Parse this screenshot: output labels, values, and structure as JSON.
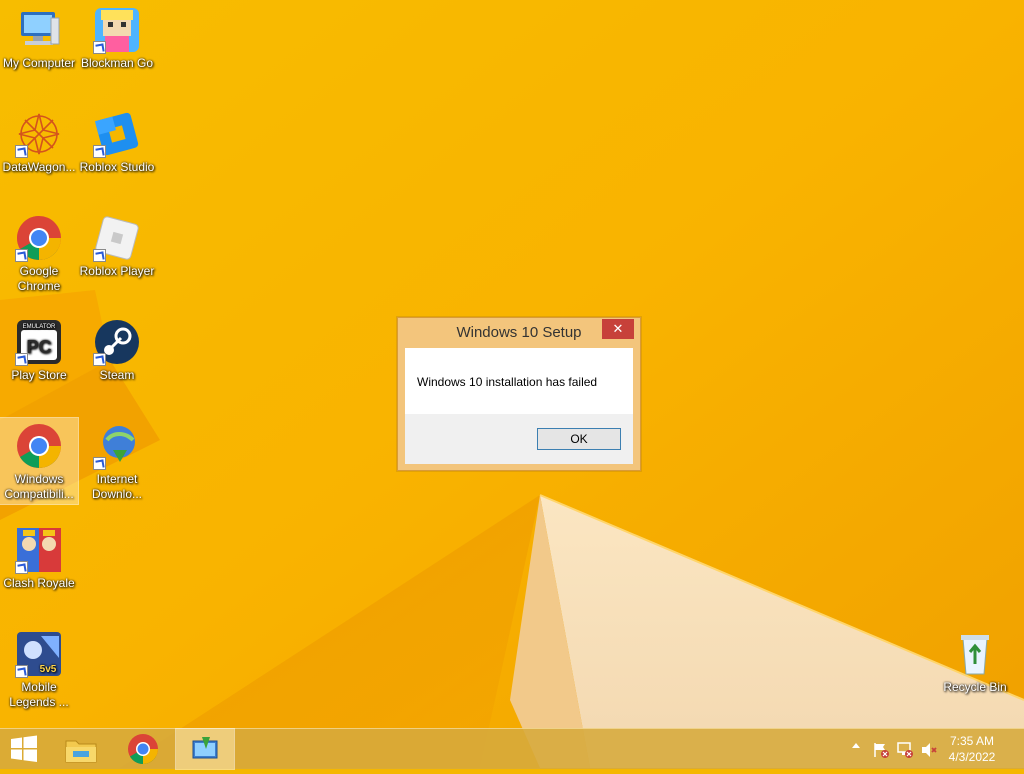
{
  "desktop": {
    "icons": [
      {
        "label": "My Computer",
        "icon": "my-computer-icon"
      },
      {
        "label": "Blockman Go",
        "icon": "blockman-go-icon"
      },
      {
        "label": "DataWagon...",
        "icon": "datawagon-icon"
      },
      {
        "label": "Roblox Studio",
        "icon": "roblox-studio-icon"
      },
      {
        "label": "Google Chrome",
        "icon": "chrome-icon"
      },
      {
        "label": "Roblox Player",
        "icon": "roblox-player-icon"
      },
      {
        "label": "Play Store",
        "icon": "play-store-emulator-icon",
        "badge": "EMULATOR",
        "text": "PC"
      },
      {
        "label": "Steam",
        "icon": "steam-icon"
      },
      {
        "label": "Windows Compatibili...",
        "icon": "chrome-icon"
      },
      {
        "label": "Internet Downlo...",
        "icon": "internet-download-manager-icon"
      },
      {
        "label": "Clash Royale",
        "icon": "clash-royale-icon"
      },
      {
        "label": "Mobile Legends ...",
        "icon": "mobile-legends-icon",
        "badge": "5v5"
      },
      {
        "label": "Recycle Bin",
        "icon": "recycle-bin-icon"
      }
    ]
  },
  "dialog": {
    "title": "Windows 10 Setup",
    "close_symbol": "✕",
    "message": "Windows 10 installation has failed",
    "ok_label": "OK"
  },
  "taskbar": {
    "start_icon": "windows-logo-icon",
    "pinned": [
      "file-explorer-icon",
      "chrome-icon",
      "windows-setup-icon"
    ],
    "tray": [
      "show-hidden-icons-icon",
      "action-center-flag-icon",
      "network-icon",
      "volume-muted-icon"
    ],
    "time": "7:35 AM",
    "date": "4/3/2022"
  },
  "colors": {
    "wallpaper": "#f5b700",
    "close_button": "#c7413a",
    "dialog_frame": "#f3c57c",
    "ok_border": "#3c7fb1"
  }
}
